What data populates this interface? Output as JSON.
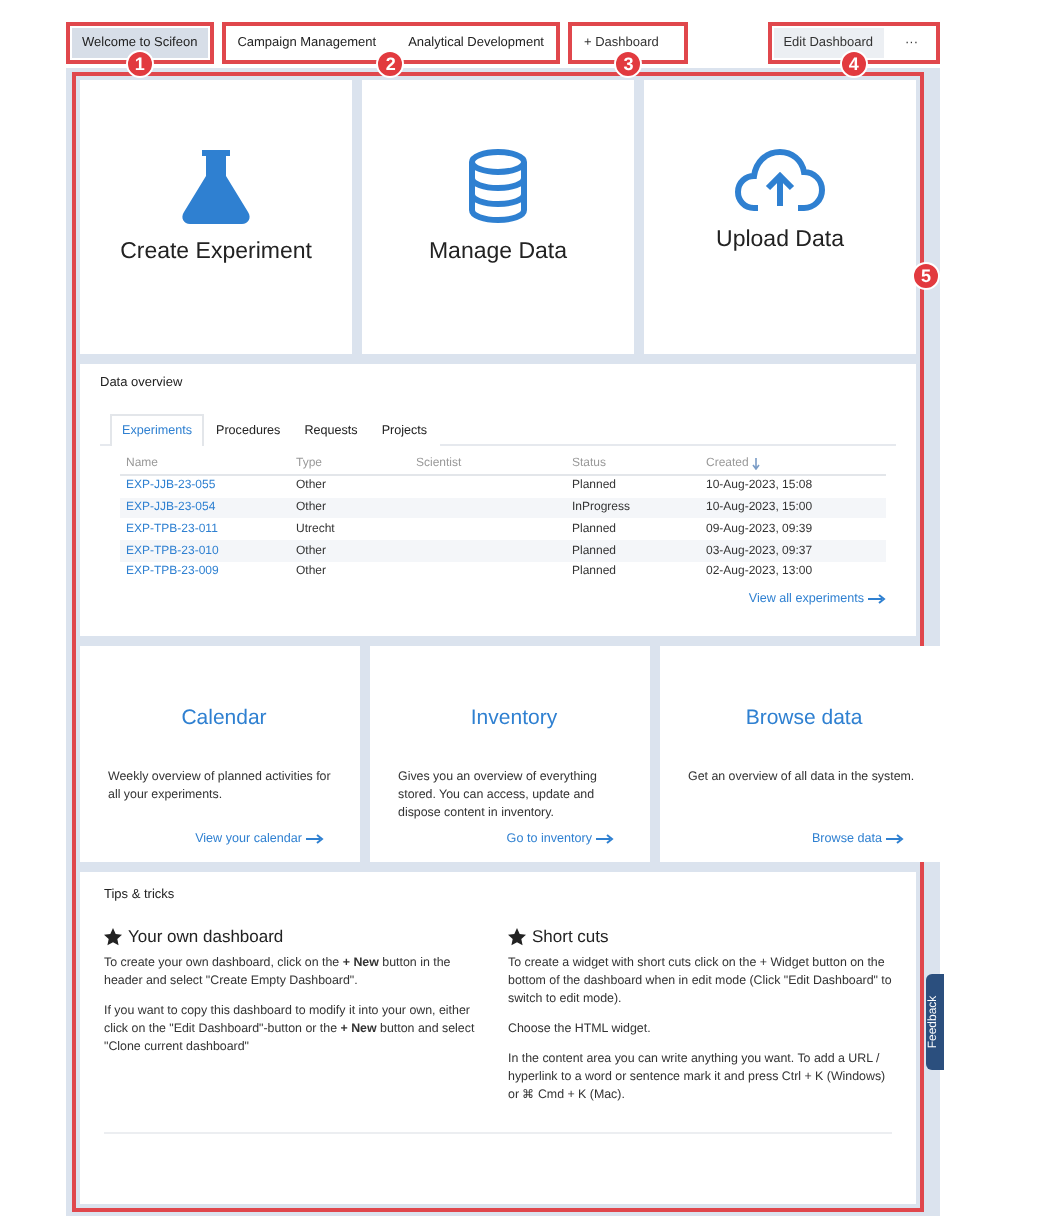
{
  "header": {
    "tabs": [
      {
        "label": "Welcome to Scifeon",
        "selected": true,
        "callout": "1"
      }
    ],
    "dashboard_tabs": [
      {
        "label": "Campaign Management",
        "selected": false
      },
      {
        "label": "Analytical Development",
        "selected": false
      }
    ],
    "dashboard_tabs_callout": "2",
    "add_button": {
      "label": "+ Dashboard",
      "callout": "3"
    },
    "edit_button": "Edit Dashboard",
    "more_button": "···",
    "actions_callout": "4"
  },
  "main_callout": "5",
  "action_tiles": [
    {
      "kind": "flask",
      "label": "Create Experiment"
    },
    {
      "kind": "database",
      "label": "Manage Data"
    },
    {
      "kind": "upload",
      "label": "Upload Data"
    }
  ],
  "data_overview": {
    "title": "Data overview",
    "tabs": [
      {
        "label": "Experiments",
        "selected": true
      },
      {
        "label": "Procedures",
        "selected": false
      },
      {
        "label": "Requests",
        "selected": false
      },
      {
        "label": "Projects",
        "selected": false
      }
    ],
    "columns": [
      "Name",
      "Type",
      "Scientist",
      "Status",
      "Created"
    ],
    "rows": [
      {
        "name": "EXP-JJB-23-055",
        "type": "Other",
        "status": "Planned",
        "created": "10-Aug-2023, 15:08"
      },
      {
        "name": "EXP-JJB-23-054",
        "type": "Other",
        "status": "InProgress",
        "created": "10-Aug-2023, 15:00"
      },
      {
        "name": "EXP-TPB-23-011",
        "type": "Utrecht",
        "status": "Planned",
        "created": "09-Aug-2023, 09:39"
      },
      {
        "name": "EXP-TPB-23-010",
        "type": "Other",
        "status": "Planned",
        "created": "03-Aug-2023, 09:37"
      },
      {
        "name": "EXP-TPB-23-009",
        "type": "Other",
        "status": "Planned",
        "created": "02-Aug-2023, 13:00"
      }
    ],
    "link": "View all experiments"
  },
  "info_tiles": [
    {
      "title": "Calendar",
      "text": "Weekly overview of planned activities for all your experiments.",
      "link": "View your calendar"
    },
    {
      "title": "Inventory",
      "text": "Gives you an overview of everything stored. You can access, update and dispose content in inventory.",
      "link": "Go to inventory"
    },
    {
      "title": "Browse data",
      "text": "Get an overview of all data in the system.",
      "link": "Browse data"
    }
  ],
  "tips": {
    "title": "Tips & tricks",
    "columns": [
      {
        "heading": "Your own dashboard",
        "paragraphs": [
          "To create your own dashboard, click on the **+ New** button in the header and select \"Create Empty Dashboard\".",
          "If you want to copy this dashboard to modify it into your own, either click on the \"Edit Dashboard\"-button or the **+ New** button and select \"Clone current dashboard\""
        ]
      },
      {
        "heading": "Short cuts",
        "paragraphs": [
          "To create a widget with short cuts click on the + Widget button on the bottom of the dashboard when in edit mode (Click \"Edit Dashboard\" to switch to edit mode).",
          "Choose the HTML widget.",
          "In the content area you can write anything you want. To add a URL / hyperlink to a word or sentence mark it and press Ctrl + K (Windows) or ⌘ Cmd + K (Mac)."
        ]
      }
    ]
  },
  "feedback": "Feedback"
}
